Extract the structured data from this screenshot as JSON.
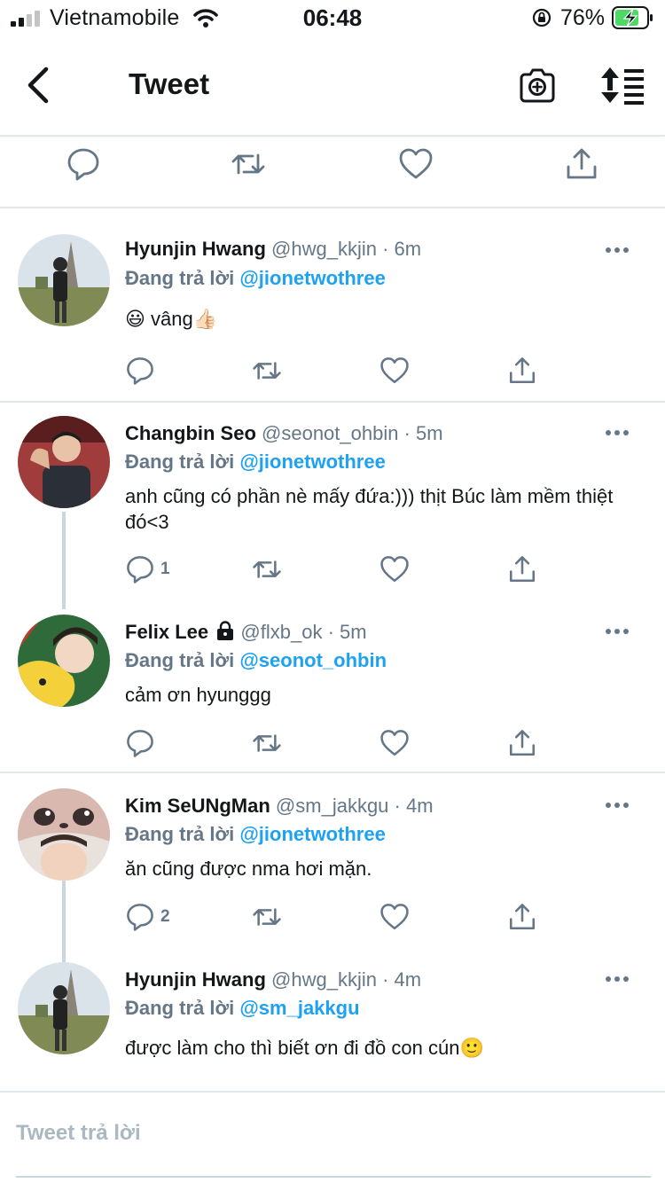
{
  "status_bar": {
    "carrier": "Vietnamobile",
    "time": "06:48",
    "battery": "76%"
  },
  "header": {
    "title": "Tweet"
  },
  "top_actions": [
    "reply-icon",
    "retweet-icon",
    "like-icon",
    "share-icon"
  ],
  "tweets": [
    {
      "name": "Hyunjin Hwang",
      "handle": "@hwg_kkjin",
      "time": "· 6m",
      "replying_prefix": "Đang trả lời",
      "mention": "@jionetwothree",
      "text": "😃  vâng👍🏻",
      "reply_count": ""
    },
    {
      "name": "Changbin Seo",
      "handle": "@seonot_ohbin",
      "time": "· 5m",
      "replying_prefix": "Đang trả lời",
      "mention": "@jionetwothree",
      "text": "anh cũng có phần nè mấy đứa:))) thịt Búc làm mềm thiệt đó<3",
      "reply_count": "1"
    },
    {
      "name": "Felix Lee",
      "handle": "@flxb_ok",
      "time": "· 5m",
      "replying_prefix": "Đang trả lời",
      "mention": "@seonot_ohbin",
      "text": "cảm ơn hyunggg",
      "reply_count": ""
    },
    {
      "name": "Kim SeUNgMan",
      "handle": "@sm_jakkgu",
      "time": "· 4m",
      "replying_prefix": "Đang trả lời",
      "mention": "@jionetwothree",
      "text": "ăn cũng được nma hơi mặn.",
      "reply_count": "2"
    },
    {
      "name": "Hyunjin Hwang",
      "handle": "@hwg_kkjin",
      "time": "· 4m",
      "replying_prefix": "Đang trả lời",
      "mention": "@sm_jakkgu",
      "text": "được làm cho thì biết ơn đi đồ con cún🙂",
      "reply_count": ""
    }
  ],
  "composer": {
    "placeholder": "Tweet trả lời"
  },
  "colors": {
    "accent": "#1da1f2",
    "muted": "#657786",
    "divider": "#e1e8ed",
    "battery": "#4cd964"
  }
}
